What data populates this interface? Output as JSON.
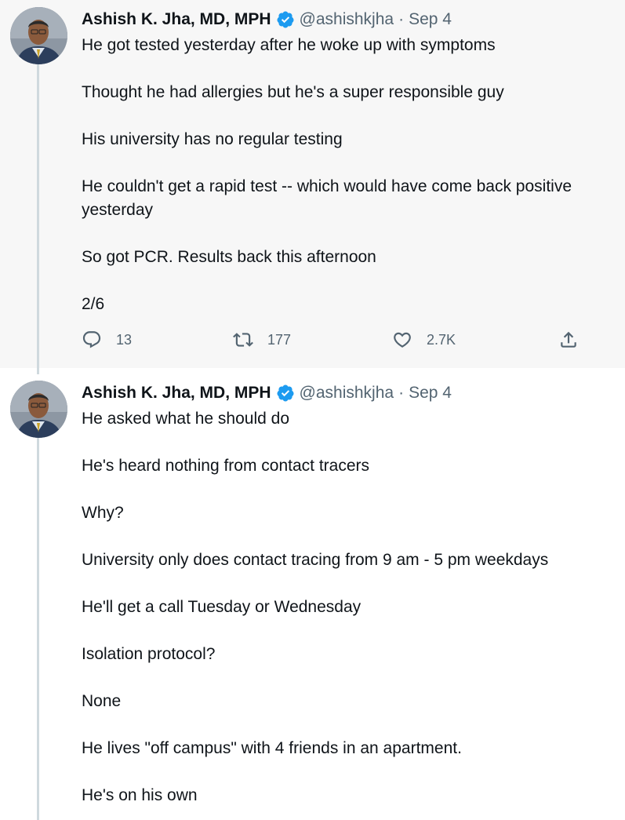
{
  "tweets": [
    {
      "author": {
        "display_name": "Ashish K. Jha, MD, MPH",
        "handle": "@ashishkjha",
        "separator": "·",
        "date": "Sep 4",
        "verified": true
      },
      "paragraphs": [
        "He got tested yesterday after he woke up with symptoms",
        "Thought he had allergies but he's a super responsible guy",
        "His university has no regular testing",
        "He couldn't get a rapid test -- which would have come back positive yesterday",
        "So got PCR. Results back this afternoon",
        "2/6"
      ],
      "actions": {
        "replies": "13",
        "retweets": "177",
        "likes": "2.7K"
      }
    },
    {
      "author": {
        "display_name": "Ashish K. Jha, MD, MPH",
        "handle": "@ashishkjha",
        "separator": "·",
        "date": "Sep 4",
        "verified": true
      },
      "paragraphs": [
        "He asked what he should do",
        "He's heard nothing from contact tracers",
        "Why?",
        "University only does contact tracing from 9 am - 5 pm weekdays",
        "He'll get a call Tuesday or Wednesday",
        "Isolation protocol?",
        "None",
        "He lives \"off campus\" with 4 friends in an apartment.",
        "He's on his own"
      ]
    }
  ],
  "colors": {
    "verified_blue": "#1d9bf0",
    "secondary_text": "#536471",
    "thread_line": "#cfd9de",
    "highlight_bg": "#f7f7f7"
  },
  "icons": {
    "reply": "reply-icon",
    "retweet": "retweet-icon",
    "like": "like-icon",
    "share": "share-icon",
    "verified": "verified-badge-icon"
  }
}
